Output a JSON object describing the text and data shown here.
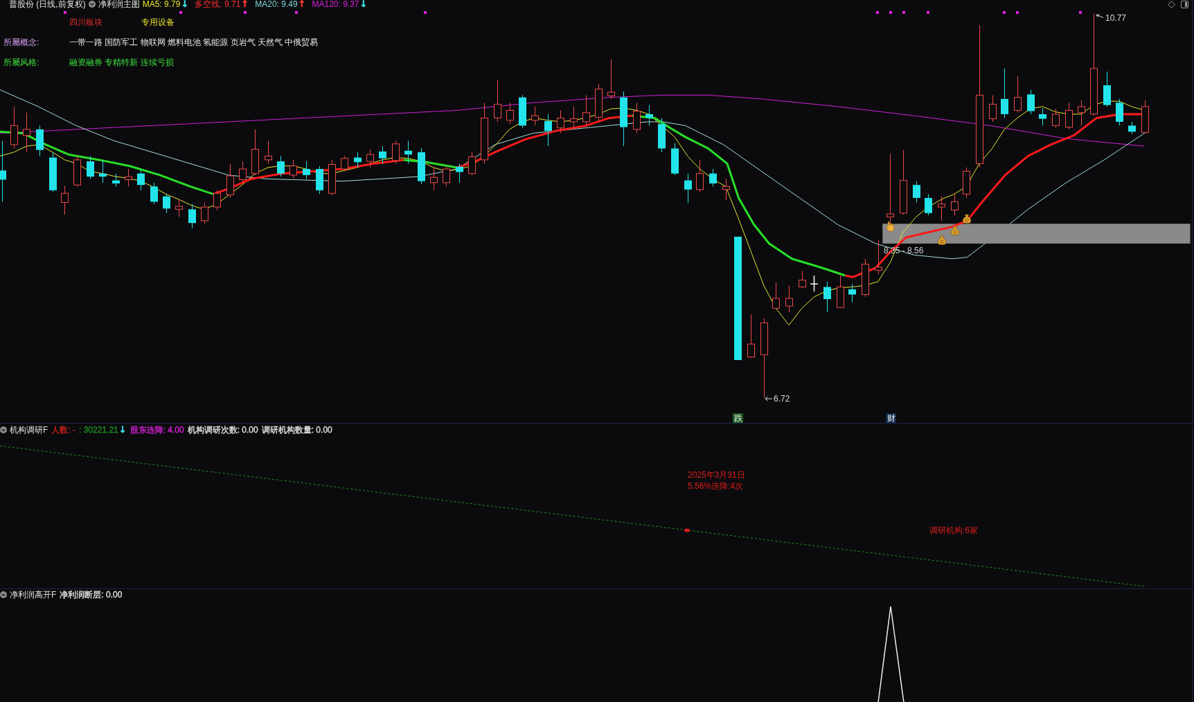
{
  "main_chart": {
    "title": "普股份 (日线,前复权)",
    "indicator_name": "净利润主图",
    "indicators": [
      {
        "text": "MA5: 9.79",
        "color": "#e6e62e",
        "arrow": {
          "text": "↓",
          "color": "#3fe3ea"
        }
      },
      {
        "text": "多空线: 9.71",
        "color": "#ff2e2e",
        "arrow": {
          "text": "↑",
          "color": "#ff3b30"
        }
      },
      {
        "text": "MA20: 9.49",
        "color": "#7fd6d6",
        "arrow": {
          "text": "↑",
          "color": "#ff3b30"
        }
      },
      {
        "text": "MA120: 9.37",
        "color": "#dd22dd",
        "arrow": {
          "text": "↓",
          "color": "#3fe3ea"
        }
      }
    ],
    "sector": "四川板块",
    "industry": "专用设备",
    "concepts": {
      "label": "所屬概念:",
      "value": "一带一路 国防军工 物联网 燃料电池 氢能源 页岩气 天然气 中俄贸易"
    },
    "styles": {
      "label": "所屬风格:",
      "value": "融资融券 专精特新 连续亏损"
    },
    "high_price": "10.77",
    "low_price": "6.72",
    "price_zone": "8.35 - 8.56",
    "event_markers": [
      {
        "text": "跌",
        "color": "#1d5c20"
      },
      {
        "text": "财",
        "color": "#12284a"
      }
    ]
  },
  "institution_panel": {
    "title": "机构调研F",
    "items": [
      {
        "text": "人数: -",
        "color": "#d02020"
      },
      {
        "text": ": 30221.21",
        "color": "#1e8c1e",
        "arrow": {
          "text": "↓",
          "color": "#3fe3ea"
        }
      },
      {
        "text": "股东连降: 4.00",
        "color": "#dd22dd"
      },
      {
        "text": "机构调研次数: 0.00",
        "color": "#e0e0e0"
      },
      {
        "text": "调研机构数量: 0.00",
        "color": "#e0e0e0"
      }
    ],
    "annotations": [
      "2025年3月31日",
      "5.56%连降:4次"
    ],
    "institution_count": "调研机构:6家"
  },
  "profit_panel": {
    "title": "净利润高开F",
    "items": [
      {
        "text": "净利润断层: 0.00",
        "color": "#e0e0e0"
      }
    ]
  }
}
